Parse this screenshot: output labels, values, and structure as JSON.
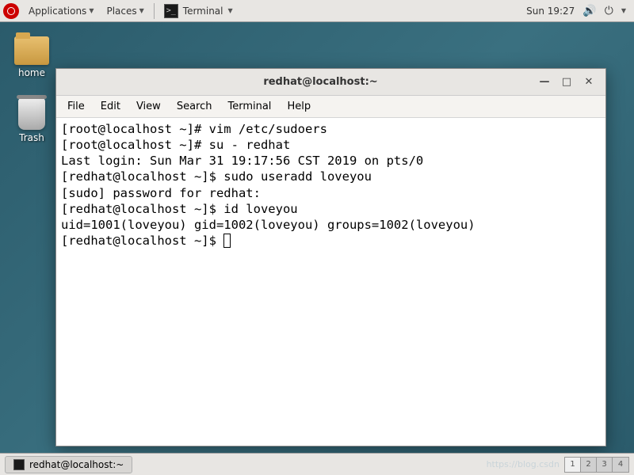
{
  "top_panel": {
    "applications": "Applications",
    "places": "Places",
    "task_label": "Terminal",
    "clock": "Sun 19:27"
  },
  "desktop": {
    "home_label": "home",
    "trash_label": "Trash"
  },
  "terminal": {
    "title": "redhat@localhost:~",
    "menu": {
      "file": "File",
      "edit": "Edit",
      "view": "View",
      "search": "Search",
      "terminal": "Terminal",
      "help": "Help"
    },
    "lines": [
      "[root@localhost ~]# vim /etc/sudoers",
      "[root@localhost ~]# su - redhat",
      "Last login: Sun Mar 31 19:17:56 CST 2019 on pts/0",
      "[redhat@localhost ~]$ sudo useradd loveyou",
      "[sudo] password for redhat:",
      "[redhat@localhost ~]$ id loveyou",
      "uid=1001(loveyou) gid=1002(loveyou) groups=1002(loveyou)"
    ],
    "prompt": "[redhat@localhost ~]$ "
  },
  "bottom_panel": {
    "task_label": "redhat@localhost:~",
    "watermark": "https://blog.csdn",
    "pager": [
      "1",
      "2",
      "3",
      "4"
    ]
  }
}
